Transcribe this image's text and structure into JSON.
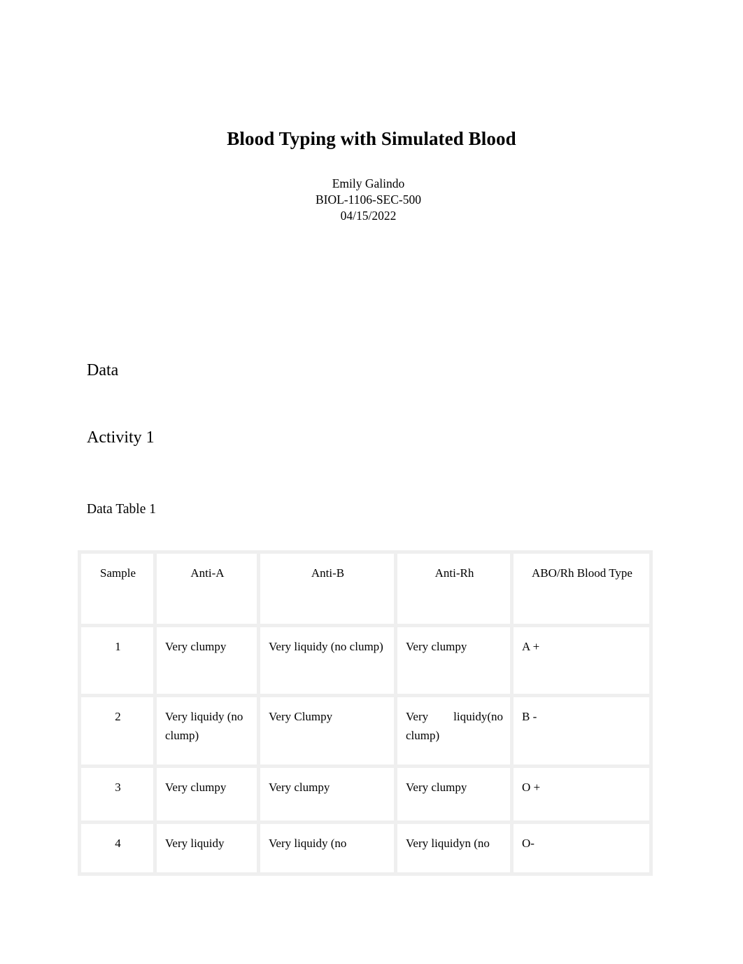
{
  "document": {
    "title": "Blood Typing with Simulated Blood",
    "author": "Emily Galindo",
    "course": "BIOL-1106-SEC-500",
    "date": "04/15/2022"
  },
  "sections": {
    "data_heading": "Data",
    "activity_heading": "Activity 1",
    "table_caption": "Data Table 1"
  },
  "table": {
    "headers": [
      "Sample",
      "Anti-A",
      "Anti-B",
      "Anti-Rh",
      "ABO/Rh Blood Type"
    ],
    "rows": [
      {
        "sample": "1",
        "anti_a": "Very clumpy",
        "anti_b": "Very liquidy (no clump)",
        "anti_rh": "Very clumpy",
        "blood_type": "A +"
      },
      {
        "sample": "2",
        "anti_a": "Very liquidy (no clump)",
        "anti_b": "Very Clumpy",
        "anti_rh": "Very liquidy(no clump)",
        "blood_type": "B -"
      },
      {
        "sample": "3",
        "anti_a": "Very clumpy",
        "anti_b": "Very clumpy",
        "anti_rh": "Very clumpy",
        "blood_type": "O +"
      },
      {
        "sample": "4",
        "anti_a": "Very liquidy",
        "anti_b": "Very liquidy (no",
        "anti_rh": "Very liquidyn (no",
        "blood_type": "O-"
      }
    ]
  },
  "colors": {
    "page_background": "#ffffff",
    "text": "#000000",
    "table_border": "#efefef"
  }
}
